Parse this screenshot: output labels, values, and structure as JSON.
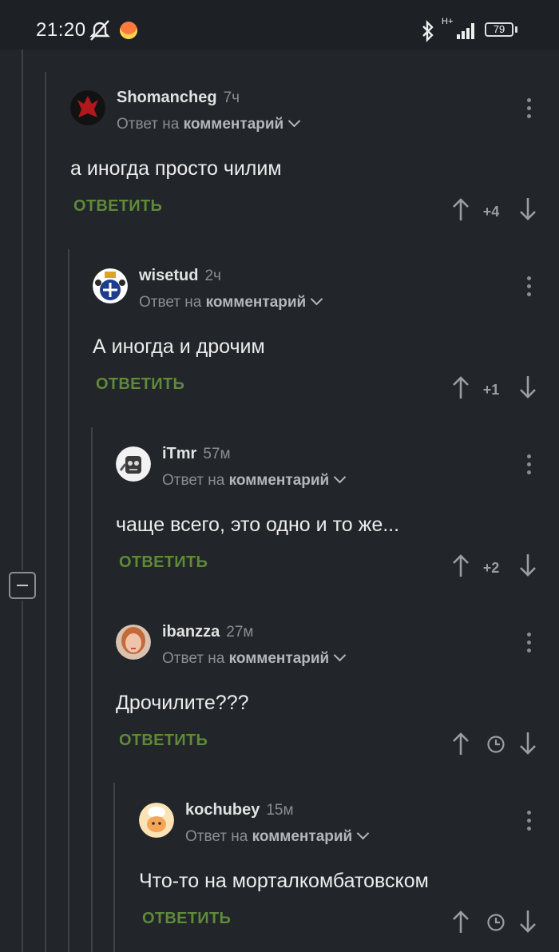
{
  "status_bar": {
    "time": "21:20",
    "network": "H+",
    "battery": "79"
  },
  "reply_prefix": "Ответ на",
  "reply_target": "комментарий",
  "reply_label": "ОТВЕТИТЬ",
  "comments": [
    {
      "author": "Shomancheg",
      "time": "7ч",
      "text": "а иногда просто чилим",
      "score": "+4",
      "avatar_icon": "horde-emblem-icon"
    },
    {
      "author": "wisetud",
      "time": "2ч",
      "text": "А иногда и дрочим",
      "score": "+1",
      "avatar_icon": "crest-icon"
    },
    {
      "author": "iTmr",
      "time": "57м",
      "text": "чаще всего, это одно и то же...",
      "score": "+2",
      "avatar_icon": "robot-icon"
    },
    {
      "author": "ibanzza",
      "time": "27м",
      "text": "Дрочилите???",
      "score": "",
      "avatar_icon": "portrait-icon"
    },
    {
      "author": "kochubey",
      "time": "15м",
      "text": "Что-то на морталкомбатовском",
      "score": "",
      "avatar_icon": "cat-chef-icon"
    }
  ],
  "colors": {
    "background": "#222529",
    "reply_green": "#5e8a3a",
    "muted": "#8a8d91"
  }
}
